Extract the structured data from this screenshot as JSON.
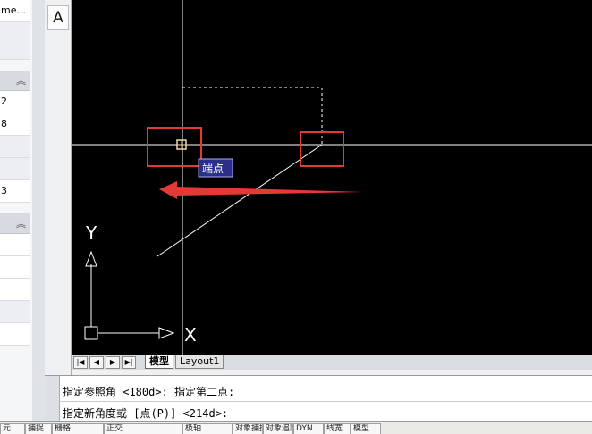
{
  "properties_panel": {
    "rows": [
      {
        "value": "me..."
      },
      {
        "value": ""
      },
      {
        "value": ""
      },
      {
        "value": "2"
      },
      {
        "value": "8"
      },
      {
        "value": ""
      },
      {
        "value": ""
      },
      {
        "value": "3"
      },
      {
        "value": ""
      },
      {
        "value": ""
      },
      {
        "value": ""
      },
      {
        "value": ""
      },
      {
        "value": ""
      }
    ],
    "collapse_glyph": "︽"
  },
  "toolbar": {
    "text_tool_label": "A"
  },
  "canvas": {
    "background": "#000000",
    "tooltip": "端点",
    "ucs_x_label": "X",
    "ucs_y_label": "Y",
    "highlight_color": "#e53935"
  },
  "layout_tabs": {
    "nav_buttons": [
      "|◀",
      "◀",
      "▶",
      "▶|"
    ],
    "tabs": [
      {
        "label": "模型",
        "active": true
      },
      {
        "label": "Layout1",
        "active": false
      }
    ]
  },
  "command": {
    "line1": "指定参照角 <180d>:  指定第二点:",
    "line2": "指定新角度或 [点(P)] <214d>:"
  },
  "status_bar": {
    "items": [
      "元",
      "捕捉",
      "栅格",
      "正交",
      "极轴",
      "对象捕捉",
      "对象追踪",
      "DYN",
      "线宽",
      "模型"
    ]
  }
}
